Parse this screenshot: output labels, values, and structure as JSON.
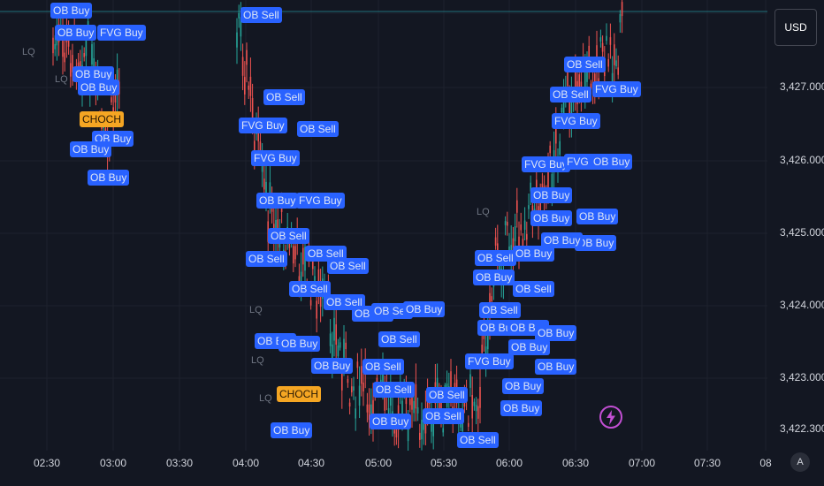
{
  "price_axis": {
    "currency": "USD",
    "labels": [
      "3,427.000",
      "3,426.000",
      "3,425.000",
      "3,424.000",
      "3,423.000",
      "3,422.300"
    ]
  },
  "time_axis": {
    "labels": [
      "02:30",
      "03:00",
      "03:30",
      "04:00",
      "04:30",
      "05:00",
      "05:30",
      "06:00",
      "06:30",
      "07:00",
      "07:30",
      "08"
    ],
    "auto_label": "A"
  },
  "icons": {
    "lightning": "lightning-icon"
  },
  "colors": {
    "background": "#131722",
    "up": "#26a69a",
    "down": "#ef5350",
    "tag": "#2962ff",
    "choch": "#f5a623"
  },
  "chart_data": {
    "type": "candlestick",
    "y_range": [
      3422.3,
      3427.6
    ],
    "annotation_labels": [
      "OB Buy",
      "OB Sell",
      "FVG Buy",
      "CHOCH",
      "LQ"
    ]
  },
  "annotations": {
    "choch": [
      "CHOCH",
      "CHOCH"
    ],
    "lq": [
      "LQ",
      "LQ",
      "LQ",
      "LQ",
      "LQ",
      "LQ"
    ],
    "tags": [
      "OB Buy",
      "OB Buy",
      "FVG Buy",
      "OB Buy",
      "OB Buy",
      "OB Buy",
      "OB Buy",
      "OB Buy",
      "OB Sell",
      "OB Sell",
      "FVG Buy",
      "OB Sell",
      "FVG Buy",
      "FVG Buy",
      "OB Sell",
      "OB Buy",
      "OB Sell",
      "OB Sell",
      "OB Sell",
      "OB Sell",
      "OB Buy",
      "OB Buy",
      "OB Buy",
      "OB Sell",
      "OB Sell",
      "OB Sell",
      "OB Buy",
      "OB Sell",
      "OB Sell",
      "OB Buy",
      "OB Sell",
      "OB Sell",
      "OB Buy",
      "OB Sell",
      "OB Sell",
      "OB Sell",
      "OB Buy",
      "FVG Buy",
      "OB Buy",
      "OB Buy",
      "OB Buy",
      "OB Sell",
      "OB Buy",
      "FVG Buy",
      "OB Buy",
      "OB Buy",
      "OB Buy",
      "OB Buy",
      "OB Sell",
      "FVG Buy",
      "OB Buy",
      "OB Buy",
      "OB Sell",
      "FVG Buy",
      "OB Buy",
      "FVG Buy",
      "OB Buy",
      "OB Buy",
      "OB Sell",
      "OB Buy"
    ]
  }
}
